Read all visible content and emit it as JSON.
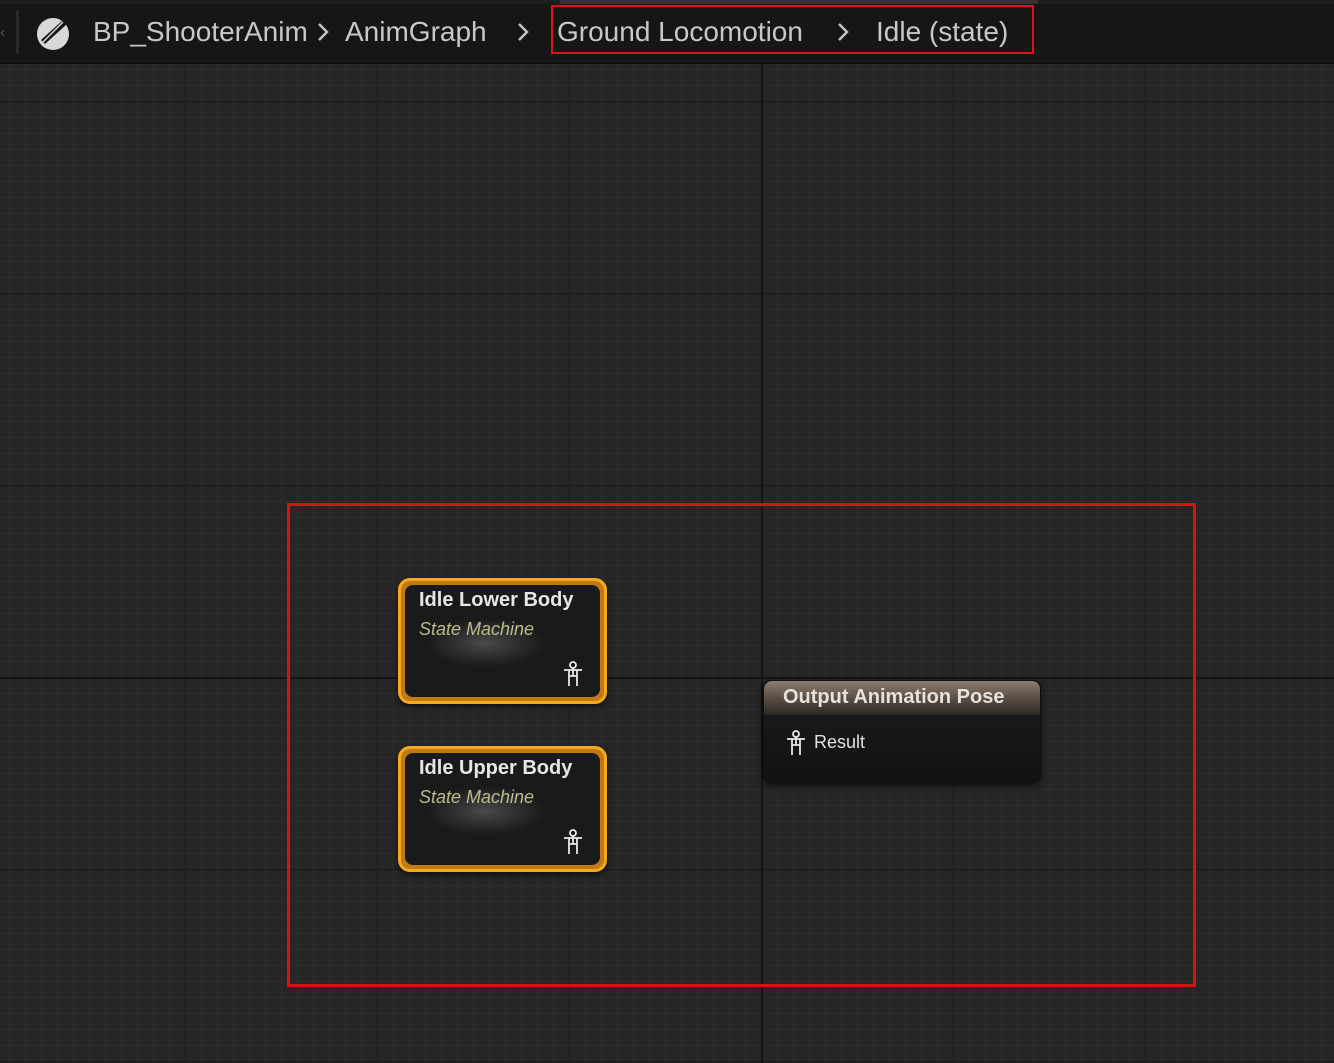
{
  "breadcrumb": {
    "items": [
      {
        "label": "BP_ShooterAnim"
      },
      {
        "label": "AnimGraph"
      },
      {
        "label": "Ground Locomotion"
      },
      {
        "label": "Idle (state)"
      }
    ]
  },
  "graph": {
    "state_machines": [
      {
        "title": "Idle Lower Body",
        "subtitle": "State Machine",
        "pin_icon": "pose-icon"
      },
      {
        "title": "Idle Upper Body",
        "subtitle": "State Machine",
        "pin_icon": "pose-icon"
      }
    ],
    "output_node": {
      "title": "Output Animation Pose",
      "pin_label": "Result",
      "pin_icon": "pose-icon"
    }
  },
  "colors": {
    "node_border": "#f4a91e",
    "highlight": "#e0101a",
    "canvas": "#262626",
    "subtitle": "#bcbc8a",
    "output_header": "#8d7c6e"
  }
}
